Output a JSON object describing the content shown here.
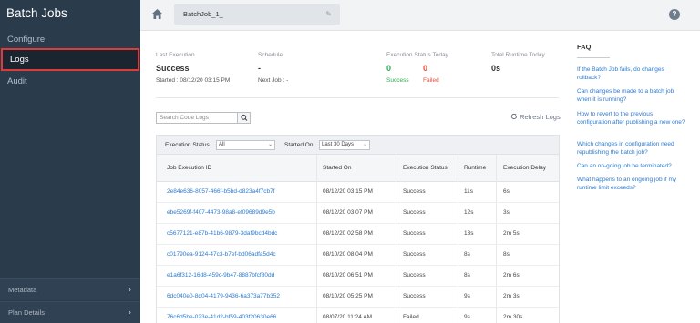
{
  "sidebar": {
    "title": "Batch Jobs",
    "items": [
      {
        "label": "Configure"
      },
      {
        "label": "Logs"
      },
      {
        "label": "Audit"
      }
    ],
    "bottom": [
      {
        "label": "Metadata"
      },
      {
        "label": "Plan Details"
      }
    ]
  },
  "topbar": {
    "tab_label": "BatchJob_1_",
    "help_glyph": "?"
  },
  "stats": {
    "last_execution": {
      "label": "Last Execution",
      "value": "Success",
      "started": "Started : 08/12/20 03:15 PM"
    },
    "schedule": {
      "label": "Schedule",
      "value": "-",
      "next_job": "Next Job :  -"
    },
    "status_today": {
      "label": "Execution Status Today",
      "success_count": "0",
      "success_label": "Success",
      "failed_count": "0",
      "failed_label": "Failed"
    },
    "runtime_today": {
      "label": "Total Runtime Today",
      "value": "0s"
    }
  },
  "search": {
    "placeholder": "Search Code Logs"
  },
  "refresh": {
    "label": "Refresh Logs"
  },
  "filters": {
    "status_label": "Execution Status",
    "status_value": "All",
    "started_label": "Started On",
    "started_value": "Last 30 Days"
  },
  "table": {
    "columns": [
      "Job Execution ID",
      "Started On",
      "Execution Status",
      "Runtime",
      "Execution Delay"
    ],
    "rows": [
      {
        "id": "2e84e636-8057-466f-b5bd-d823a4f7cb7f",
        "started": "08/12/20 03:15 PM",
        "status": "Success",
        "runtime": "11s",
        "delay": "6s"
      },
      {
        "id": "ebe5269f-f407-4473-98a8-ef09689d9e5b",
        "started": "08/12/20 03:07 PM",
        "status": "Success",
        "runtime": "12s",
        "delay": "3s"
      },
      {
        "id": "c5677121-e87b-41b6-9879-3daf9bcd4bdc",
        "started": "08/12/20 02:58 PM",
        "status": "Success",
        "runtime": "13s",
        "delay": "2m 5s"
      },
      {
        "id": "c01790ea-9124-47c3-b7ef-bd06adfa5d4c",
        "started": "08/10/20 08:04 PM",
        "status": "Success",
        "runtime": "8s",
        "delay": "8s"
      },
      {
        "id": "e1a6f312-16d8-459c-9b47-8887bfcf80dd",
        "started": "08/10/20 06:51 PM",
        "status": "Success",
        "runtime": "8s",
        "delay": "2m 6s"
      },
      {
        "id": "6dc040e0-8d04-4179-9436-6a373a77b352",
        "started": "08/10/20 05:25 PM",
        "status": "Success",
        "runtime": "9s",
        "delay": "2m 3s"
      },
      {
        "id": "76c6d5be-023e-41d2-bf59-403f20630e66",
        "started": "08/07/20 11:24 AM",
        "status": "Failed",
        "runtime": "9s",
        "delay": "2m 30s"
      }
    ]
  },
  "faq": {
    "heading": "FAQ",
    "questions": [
      "If the Batch Job fails, do changes rollback?",
      "Can changes be made to a batch job when it is running?",
      "How to revert to the previous configuration after publishing a new one?",
      "Which changes in configuration need republishing the batch job?",
      "Can an on-going job be terminated?",
      "What happens to an ongoing job if my runtime limit exceeds?"
    ]
  },
  "colors": {
    "sidebar_bg": "#2a3b4c",
    "success": "#2cab51",
    "failed": "#e8503a",
    "link": "#2b7bd0",
    "highlight_border": "#e03b3b"
  },
  "icons": {
    "home": "home-icon",
    "edit": "pencil-icon",
    "help": "help-icon",
    "search": "search-icon",
    "refresh": "refresh-icon",
    "chevron": "chevron-right-icon"
  }
}
